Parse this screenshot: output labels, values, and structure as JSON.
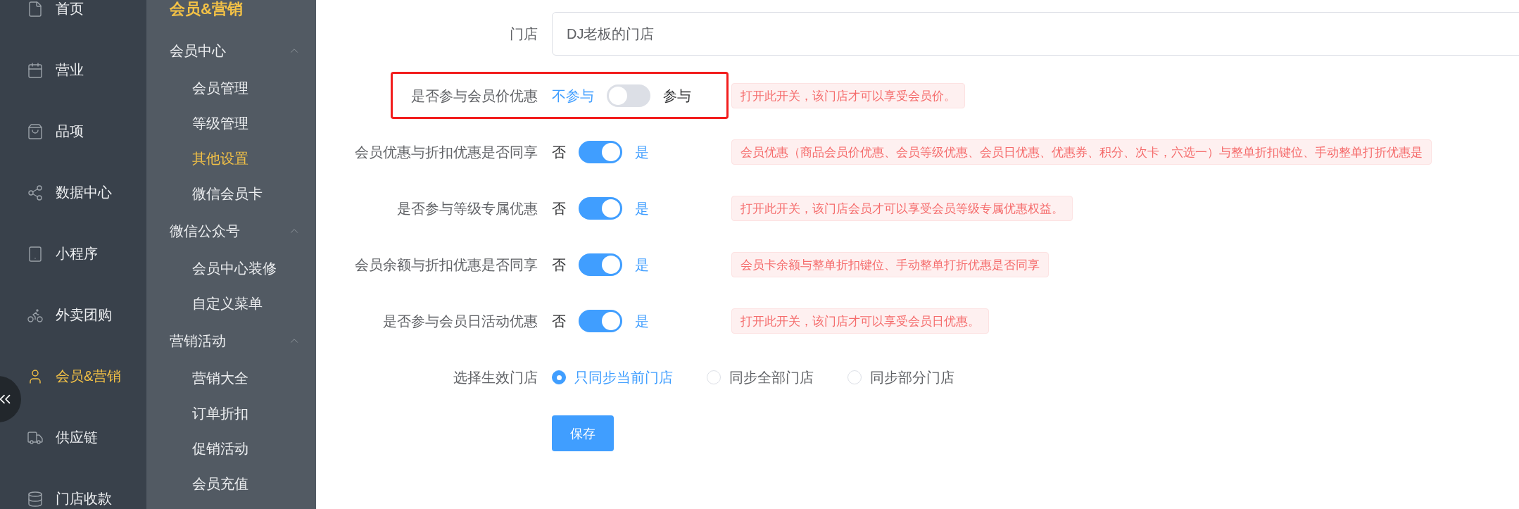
{
  "nav": {
    "items": [
      {
        "label": "首页",
        "selected": false
      },
      {
        "label": "营业",
        "selected": false
      },
      {
        "label": "品项",
        "selected": false
      },
      {
        "label": "数据中心",
        "selected": false
      },
      {
        "label": "小程序",
        "selected": false
      },
      {
        "label": "外卖团购",
        "selected": false
      },
      {
        "label": "会员&营销",
        "selected": true
      },
      {
        "label": "供应链",
        "selected": false
      },
      {
        "label": "门店收款",
        "selected": false
      }
    ]
  },
  "submenu": {
    "title": "会员&营销",
    "groups": [
      {
        "label": "会员中心",
        "expanded": true,
        "children": [
          {
            "label": "会员管理",
            "selected": false
          },
          {
            "label": "等级管理",
            "selected": false
          },
          {
            "label": "其他设置",
            "selected": true
          },
          {
            "label": "微信会员卡",
            "selected": false
          }
        ]
      },
      {
        "label": "微信公众号",
        "expanded": true,
        "children": [
          {
            "label": "会员中心装修",
            "selected": false
          },
          {
            "label": "自定义菜单",
            "selected": false
          }
        ]
      },
      {
        "label": "营销活动",
        "expanded": true,
        "children": [
          {
            "label": "营销大全",
            "selected": false
          },
          {
            "label": "订单折扣",
            "selected": false
          },
          {
            "label": "促销活动",
            "selected": false
          },
          {
            "label": "会员充值",
            "selected": false
          }
        ]
      }
    ]
  },
  "form": {
    "store": {
      "label": "门店",
      "value": "DJ老板的门店"
    },
    "switches": [
      {
        "label": "是否参与会员价优惠",
        "off_text": "不参与",
        "on_text": "参与",
        "on": false,
        "highlighted": true,
        "tip": "打开此开关，该门店才可以享受会员价。"
      },
      {
        "label": "会员优惠与折扣优惠是否同享",
        "off_text": "否",
        "on_text": "是",
        "on": true,
        "highlighted": false,
        "tip": "会员优惠（商品会员价优惠、会员等级优惠、会员日优惠、优惠券、积分、次卡，六选一）与整单折扣键位、手动整单打折优惠是"
      },
      {
        "label": "是否参与等级专属优惠",
        "off_text": "否",
        "on_text": "是",
        "on": true,
        "highlighted": false,
        "tip": "打开此开关，该门店会员才可以享受会员等级专属优惠权益。"
      },
      {
        "label": "会员余额与折扣优惠是否同享",
        "off_text": "否",
        "on_text": "是",
        "on": true,
        "highlighted": false,
        "tip": "会员卡余额与整单折扣键位、手动整单打折优惠是否同享"
      },
      {
        "label": "是否参与会员日活动优惠",
        "off_text": "否",
        "on_text": "是",
        "on": true,
        "highlighted": false,
        "tip": "打开此开关，该门店才可以享受会员日优惠。"
      }
    ],
    "scope": {
      "label": "选择生效门店",
      "options": [
        {
          "label": "只同步当前门店",
          "selected": true
        },
        {
          "label": "同步全部门店",
          "selected": false
        },
        {
          "label": "同步部分门店",
          "selected": false
        }
      ]
    },
    "save_button": "保存"
  }
}
